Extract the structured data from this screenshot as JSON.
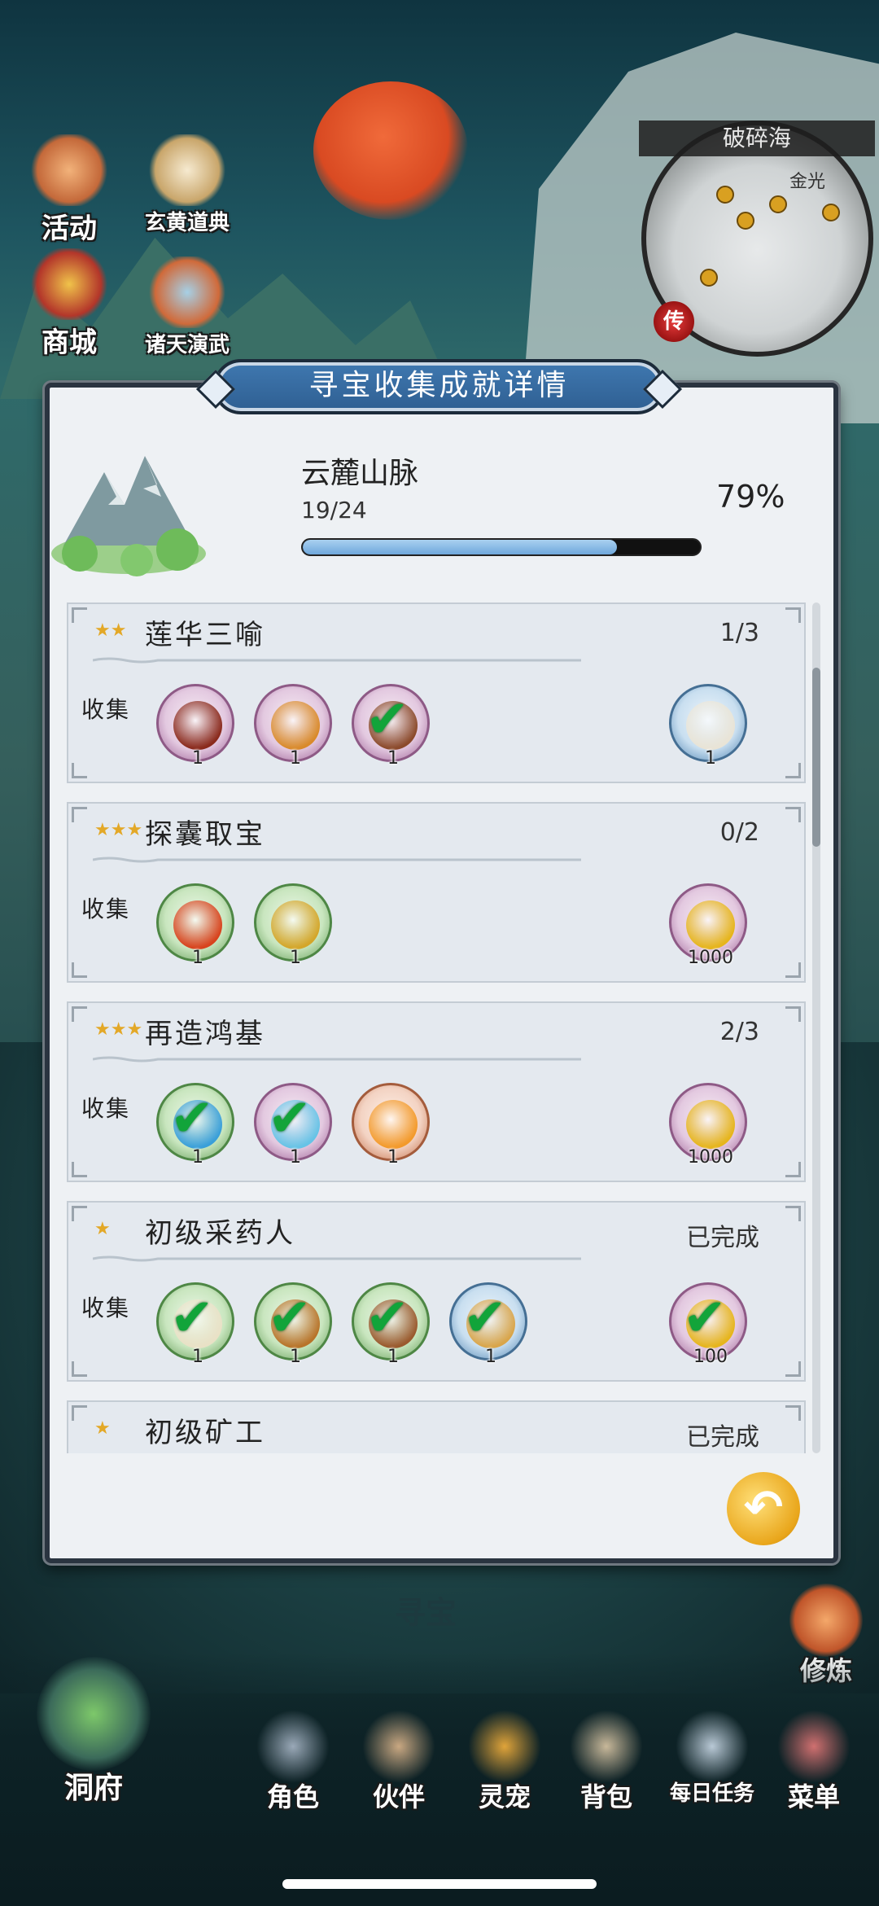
{
  "top_icons": [
    {
      "label": "活动",
      "icon": "mushroom-icon"
    },
    {
      "label": "玄黄道典",
      "icon": "scroll-book-icon"
    },
    {
      "label": "商城",
      "icon": "shop-icon"
    },
    {
      "label": "诸天演武",
      "icon": "arena-icon"
    }
  ],
  "minimap": {
    "title": "破碎海",
    "labels": [
      "金光"
    ],
    "marker": "传"
  },
  "panel": {
    "title": "寻宝收集成就详情",
    "zone": {
      "name": "云麓山脉",
      "count": "19/24",
      "percent": "79%",
      "progress": 0.79
    },
    "collect_label": "收集",
    "cards": [
      {
        "title": "莲华三喻",
        "stars": "★★",
        "status": "1/3",
        "items": [
          {
            "qty": "1",
            "bg": "purple",
            "icon": "robe-icon",
            "collected": false
          },
          {
            "qty": "1",
            "bg": "purple",
            "icon": "crown-icon",
            "collected": false
          },
          {
            "qty": "1",
            "bg": "purple",
            "icon": "prayer-beads-icon",
            "collected": true
          }
        ],
        "reward": {
          "qty": "1",
          "bg": "blue",
          "icon": "scroll-icon",
          "collected": false
        }
      },
      {
        "title": "探囊取宝",
        "stars": "★★★",
        "status": "0/2",
        "items": [
          {
            "qty": "1",
            "bg": "green",
            "icon": "fire-sword-icon",
            "collected": false
          },
          {
            "qty": "1",
            "bg": "green",
            "icon": "coin-icon",
            "collected": false
          }
        ],
        "reward": {
          "qty": "1000",
          "bg": "purple",
          "icon": "gold-gem-icon",
          "collected": false
        }
      },
      {
        "title": "再造鸿基",
        "stars": "★★★",
        "status": "2/3",
        "items": [
          {
            "qty": "1",
            "bg": "green",
            "icon": "spirit-icon",
            "collected": true
          },
          {
            "qty": "1",
            "bg": "purple",
            "icon": "swirl-icon",
            "collected": true
          },
          {
            "qty": "1",
            "bg": "orange",
            "icon": "flame-icon",
            "collected": false
          }
        ],
        "reward": {
          "qty": "1000",
          "bg": "purple",
          "icon": "gold-gem-icon",
          "collected": false
        }
      },
      {
        "title": "初级采药人",
        "stars": "★",
        "status": "已完成",
        "items": [
          {
            "qty": "1",
            "bg": "green",
            "icon": "herb-icon",
            "collected": true
          },
          {
            "qty": "1",
            "bg": "green",
            "icon": "root-icon",
            "collected": true
          },
          {
            "qty": "1",
            "bg": "green",
            "icon": "branch-icon",
            "collected": true
          },
          {
            "qty": "1",
            "bg": "blue",
            "icon": "flower-icon",
            "collected": true
          }
        ],
        "reward": {
          "qty": "100",
          "bg": "purple",
          "icon": "gold-gem-icon",
          "collected": true
        }
      },
      {
        "title": "初级矿工",
        "stars": "★",
        "status": "已完成",
        "items": [],
        "reward": null
      }
    ]
  },
  "seek_label": "寻宝",
  "side_buttons": [
    {
      "label": "修炼",
      "icon": "meditate-icon"
    }
  ],
  "bottom_nav": [
    {
      "label": "洞府",
      "icon": "cave-icon"
    },
    {
      "label": "角色",
      "icon": "character-icon"
    },
    {
      "label": "伙伴",
      "icon": "partner-icon"
    },
    {
      "label": "灵宠",
      "icon": "pet-icon"
    },
    {
      "label": "背包",
      "icon": "bag-icon"
    },
    {
      "label": "每日任务",
      "icon": "daily-task-icon"
    },
    {
      "label": "菜单",
      "icon": "menu-icon"
    }
  ]
}
